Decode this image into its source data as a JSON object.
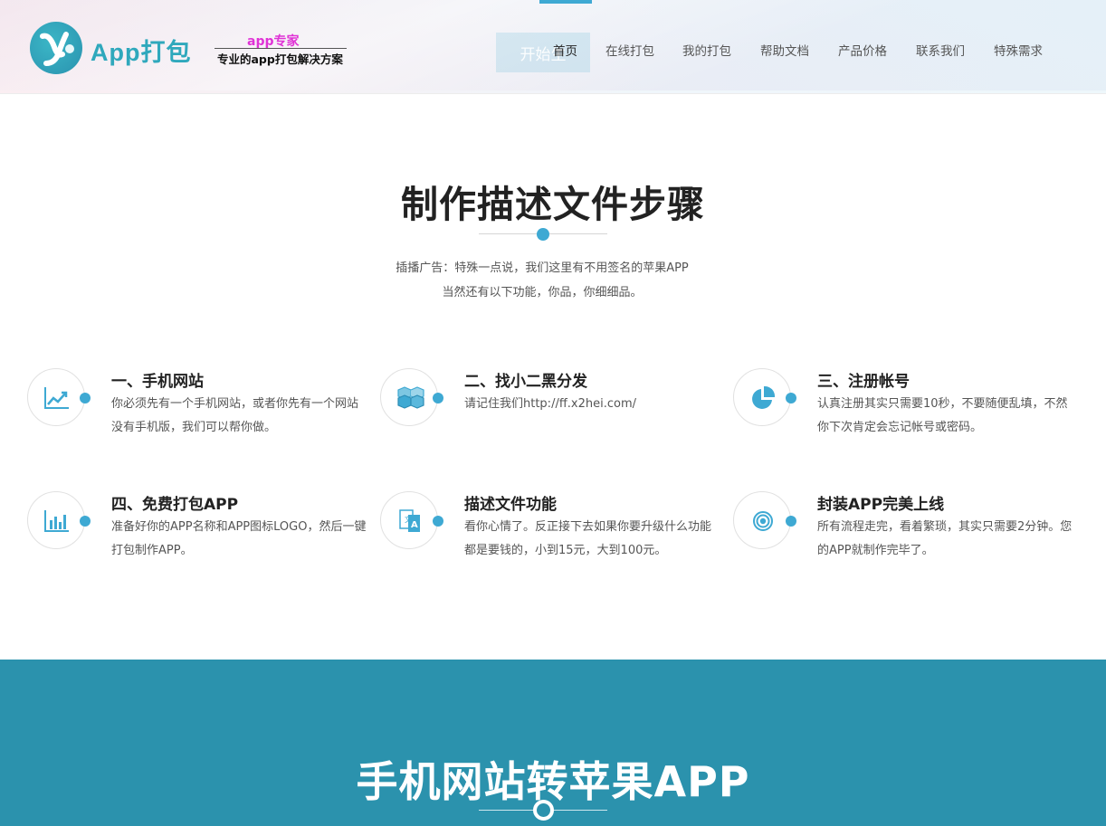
{
  "header": {
    "logo_text": "App打包",
    "tagline_top": "app专家",
    "tagline_bottom": "专业的app打包解决方案",
    "hero_button": "开始生",
    "nav": [
      {
        "label": "首页",
        "active": true
      },
      {
        "label": "在线打包"
      },
      {
        "label": "我的打包"
      },
      {
        "label": "帮助文档"
      },
      {
        "label": "产品价格"
      },
      {
        "label": "联系我们"
      },
      {
        "label": "特殊需求"
      }
    ],
    "accent": "#3ea9d3"
  },
  "section": {
    "title": "制作描述文件步骤",
    "intro_line1": "插播广告：特殊一点说，我们这里有不用签名的苹果APP",
    "intro_line2": "当然还有以下功能，你品，你细细品。",
    "features": [
      {
        "icon": "trend-chart-icon",
        "title": "一、手机网站",
        "desc": "你必须先有一个手机网站，或者你先有一个网站没有手机版，我们可以帮你做。"
      },
      {
        "icon": "cubes-icon",
        "title": "二、找小二黑分发",
        "desc": "请记住我们http://ff.x2hei.com/"
      },
      {
        "icon": "pie-chart-icon",
        "title": "三、注册帐号",
        "desc": "认真注册其实只需要10秒，不要随便乱填，不然你下次肯定会忘记帐号或密码。"
      },
      {
        "icon": "bar-chart-icon",
        "title": "四、免费打包APP",
        "desc": "准备好你的APP名称和APP图标LOGO，然后一键打包制作APP。"
      },
      {
        "icon": "translate-icon",
        "title": "描述文件功能",
        "desc": "看你心情了。反正接下去如果你要升级什么功能都是要钱的，小到15元，大到100元。"
      },
      {
        "icon": "target-icon",
        "title": "封装APP完美上线",
        "desc": "所有流程走完，看着繁琐，其实只需要2分钟。您的APP就制作完毕了。"
      }
    ]
  },
  "band": {
    "title": "手机网站转苹果APP",
    "color": "#2b92ad"
  }
}
